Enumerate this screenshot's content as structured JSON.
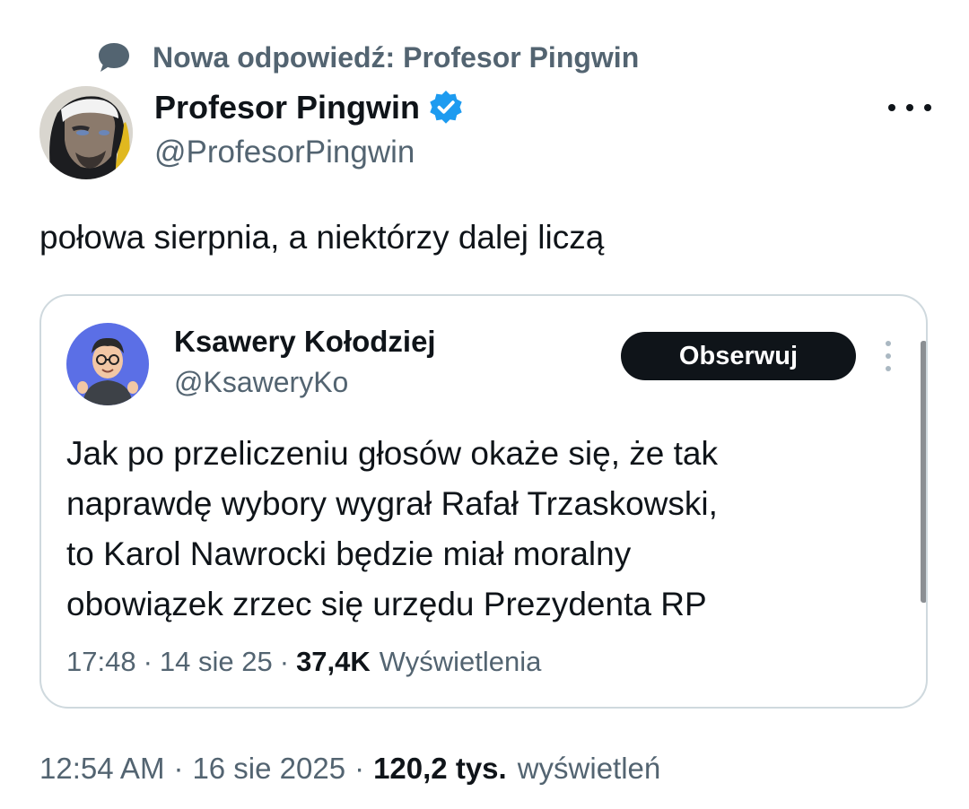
{
  "reply_context": {
    "text": "Nowa odpowiedź: Profesor Pingwin",
    "icon": "speech-bubble-icon"
  },
  "author": {
    "name": "Profesor Pingwin",
    "handle": "@ProfesorPingwin",
    "verified": true,
    "verified_color": "#1d9bf0"
  },
  "tweet": {
    "text": "połowa sierpnia, a niektórzy dalej liczą",
    "time": "12:54 AM",
    "date": "16 sie 2025",
    "views_count": "120,2 tys.",
    "views_label": "wyświetleń"
  },
  "quote": {
    "name": "Ksawery Kołodziej",
    "handle": "@KsaweryKo",
    "follow_label": "Obserwuj",
    "lines": [
      "Jak po przeliczeniu głosów okaże się, że tak",
      "naprawdę wybory wygrał Rafał Trzaskowski,",
      "to Karol Nawrocki będzie miał moralny",
      "obowiązek zrzec się urzędu Prezydenta RP"
    ],
    "time": "17:48",
    "date": "14 sie 25",
    "views_count": "37,4K",
    "views_label": "Wyświetlenia"
  },
  "separator": "·",
  "colors": {
    "text_primary": "#0f1419",
    "text_secondary": "#536471",
    "border": "#cfd9de",
    "button_bg": "#0f1419"
  }
}
